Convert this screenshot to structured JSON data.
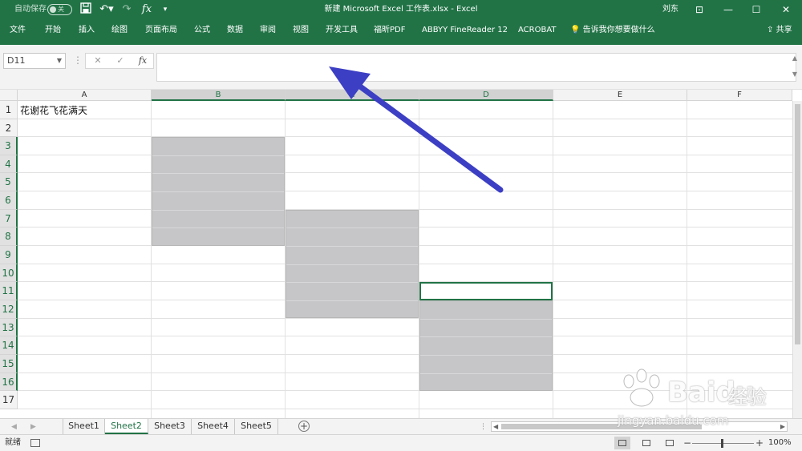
{
  "titlebar": {
    "autosave_label": "自动保存",
    "autosave_state": "关",
    "title": "新建 Microsoft Excel 工作表.xlsx  -  Excel",
    "user": "刘东"
  },
  "menu": {
    "items": [
      "文件",
      "开始",
      "插入",
      "绘图",
      "页面布局",
      "公式",
      "数据",
      "审阅",
      "视图",
      "开发工具",
      "福昕PDF",
      "ABBYY FineReader 12",
      "ACROBAT"
    ],
    "tell_me": "告诉我你想要做什么",
    "share": "共享"
  },
  "formula_bar": {
    "name_box": "D11",
    "formula_value": ""
  },
  "grid": {
    "columns": [
      "A",
      "B",
      "C",
      "D",
      "E",
      "F"
    ],
    "selected_columns": [
      "B",
      "C",
      "D"
    ],
    "rows": [
      "1",
      "2",
      "3",
      "4",
      "5",
      "6",
      "7",
      "8",
      "9",
      "10",
      "11",
      "12",
      "13",
      "14",
      "15",
      "16",
      "17"
    ],
    "selected_rows": [
      "3",
      "4",
      "5",
      "6",
      "7",
      "8",
      "9",
      "10",
      "11",
      "12",
      "13",
      "14",
      "15",
      "16"
    ],
    "a1_value": "花谢花飞花满天",
    "active_cell": "D11",
    "fill_color": "#c6c6c8"
  },
  "sheets": {
    "tabs": [
      "Sheet1",
      "Sheet2",
      "Sheet3",
      "Sheet4",
      "Sheet5"
    ],
    "active": "Sheet2"
  },
  "status": {
    "ready": "就绪",
    "zoom": "100%"
  },
  "watermark": {
    "brand": "Bai",
    "brand2": "du",
    "cn": "经验",
    "url": "jingyan.baidu.com"
  },
  "colors": {
    "excel_green": "#217346",
    "arrow": "#3c3fc4"
  }
}
